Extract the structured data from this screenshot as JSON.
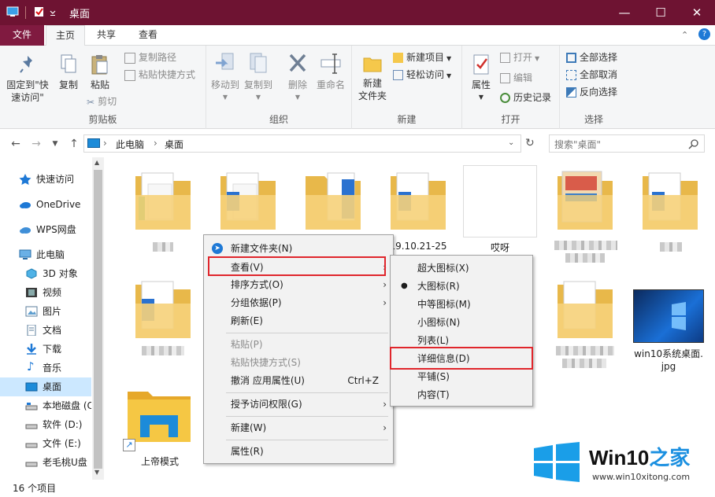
{
  "window": {
    "title": "桌面"
  },
  "ribbon_tabs": [
    "文件",
    "主页",
    "共享",
    "查看"
  ],
  "ribbon": {
    "clipboard": {
      "pin": "固定到\"快\n速访问\"",
      "copy": "复制",
      "paste": "粘贴",
      "copy_path": "复制路径",
      "paste_shortcut": "粘贴快捷方式",
      "cut": "剪切",
      "label": "剪贴板"
    },
    "organize": {
      "move_to": "移动到",
      "copy_to": "复制到",
      "delete": "删除",
      "rename": "重命名",
      "label": "组织"
    },
    "new": {
      "new_folder": "新建\n文件夹",
      "new_item": "新建项目",
      "easy_access": "轻松访问",
      "label": "新建"
    },
    "open": {
      "properties": "属性",
      "open": "打开",
      "edit": "编辑",
      "history": "历史记录",
      "label": "打开"
    },
    "select": {
      "select_all": "全部选择",
      "select_none": "全部取消",
      "invert": "反向选择",
      "label": "选择"
    }
  },
  "address": {
    "crumbs": [
      "此电脑",
      "桌面"
    ],
    "search_placeholder": "搜索\"桌面\""
  },
  "nav": [
    {
      "label": "快速访问",
      "icon": "star-icon"
    },
    {
      "label": "OneDrive",
      "icon": "cloud-icon"
    },
    {
      "label": "WPS网盘",
      "icon": "cloud-icon"
    },
    {
      "label": "此电脑",
      "icon": "computer-icon"
    },
    {
      "label": "3D 对象",
      "icon": "cube-icon"
    },
    {
      "label": "视频",
      "icon": "video-icon"
    },
    {
      "label": "图片",
      "icon": "picture-icon"
    },
    {
      "label": "文档",
      "icon": "document-icon"
    },
    {
      "label": "下载",
      "icon": "download-icon"
    },
    {
      "label": "音乐",
      "icon": "music-icon"
    },
    {
      "label": "桌面",
      "icon": "desktop-icon"
    },
    {
      "label": "本地磁盘 (C",
      "icon": "drive-icon"
    },
    {
      "label": "软件 (D:)",
      "icon": "drive-icon"
    },
    {
      "label": "文件 (E:)",
      "icon": "drive-icon"
    },
    {
      "label": "老毛桃U盘",
      "icon": "usb-drive-icon"
    }
  ],
  "files": [
    {
      "name": "19.10.21-25"
    },
    {
      "name": "哎呀"
    },
    {
      "name": "win10系统桌面.\njpg"
    },
    {
      "name": "上帝模式"
    }
  ],
  "status": {
    "count": "16 个项目"
  },
  "context_menu": {
    "items": [
      {
        "label": "新建文件夹(N)"
      },
      {
        "label": "查看(V)"
      },
      {
        "label": "排序方式(O)"
      },
      {
        "label": "分组依据(P)"
      },
      {
        "label": "刷新(E)"
      },
      {
        "label": "粘贴(P)"
      },
      {
        "label": "粘贴快捷方式(S)"
      },
      {
        "label": "撤消 应用属性(U)",
        "shortcut": "Ctrl+Z"
      },
      {
        "label": "授予访问权限(G)"
      },
      {
        "label": "新建(W)"
      },
      {
        "label": "属性(R)"
      }
    ]
  },
  "view_submenu": {
    "items": [
      "超大图标(X)",
      "大图标(R)",
      "中等图标(M)",
      "小图标(N)",
      "列表(L)",
      "详细信息(D)",
      "平铺(S)",
      "内容(T)"
    ],
    "selected": "大图标(R)"
  },
  "watermark": {
    "brand_a": "Win10",
    "brand_b": "之家",
    "url": "www.win10xitong.com"
  },
  "colors": {
    "titlebar": "#6e1332",
    "file_tab": "#801a40",
    "highlight_box": "#e0262c",
    "selection": "#cce8ff"
  }
}
